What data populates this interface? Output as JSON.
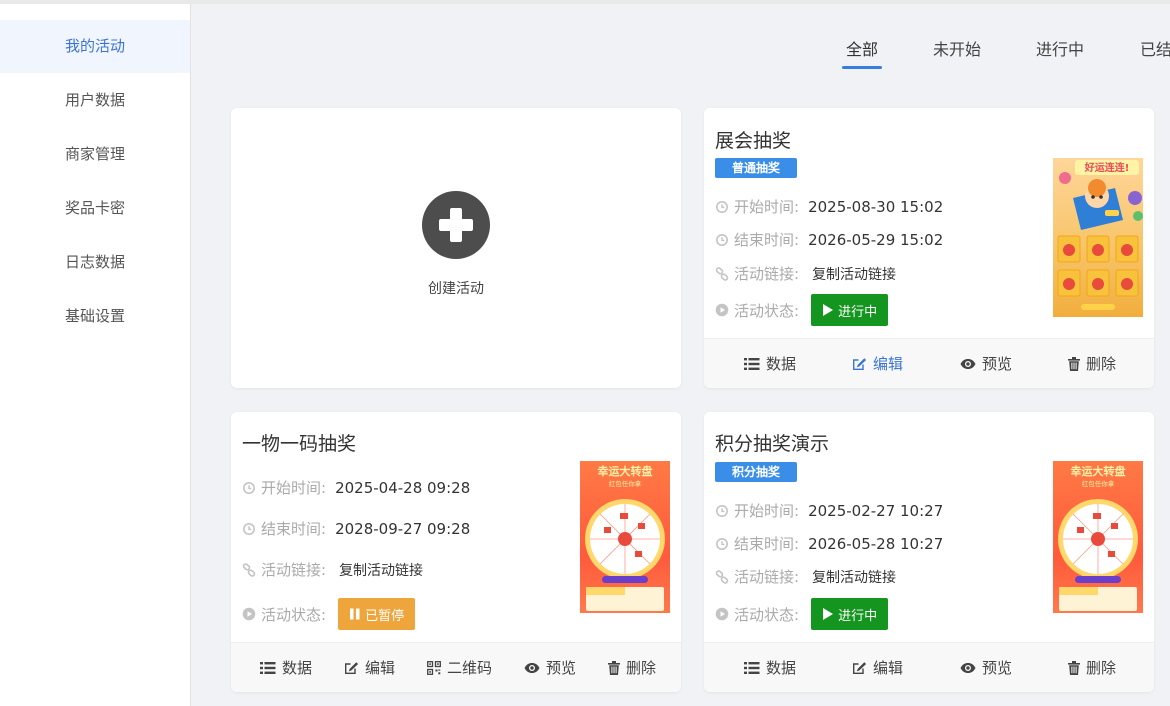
{
  "sidebar": {
    "items": [
      {
        "label": "我的活动",
        "active": true
      },
      {
        "label": "用户数据"
      },
      {
        "label": "商家管理"
      },
      {
        "label": "奖品卡密"
      },
      {
        "label": "日志数据"
      },
      {
        "label": "基础设置"
      }
    ]
  },
  "tabs": [
    {
      "label": "全部",
      "active": true
    },
    {
      "label": "未开始"
    },
    {
      "label": "进行中"
    },
    {
      "label": "已结"
    }
  ],
  "create": {
    "label": "创建活动"
  },
  "labels": {
    "start": "开始时间:",
    "end": "结束时间:",
    "link": "活动链接:",
    "status": "活动状态:",
    "copy_link": "复制活动链接"
  },
  "actions": {
    "data": "数据",
    "edit": "编辑",
    "qrcode": "二维码",
    "preview": "预览",
    "delete": "删除"
  },
  "cards": [
    {
      "title": "展会抽奖",
      "badge": "普通抽奖",
      "start": "2025-08-30 15:02",
      "end": "2026-05-29 15:02",
      "status": "进行中",
      "thumb_text": "好运连连!"
    },
    {
      "title": "一物一码抽奖",
      "start": "2025-04-28 09:28",
      "end": "2028-09-27 09:28",
      "status": "已暂停",
      "thumb_text": "幸运大转盘",
      "thumb_sub": "红包任你拿"
    },
    {
      "title": "积分抽奖演示",
      "badge": "积分抽奖",
      "start": "2025-02-27 10:27",
      "end": "2026-05-28 10:27",
      "status": "进行中",
      "thumb_text": "幸运大转盘",
      "thumb_sub": "红包任你拿"
    }
  ],
  "colors": {
    "accent": "#3a75d6",
    "badge": "#3a8ee8",
    "running": "#14951f",
    "paused": "#eea63c"
  }
}
